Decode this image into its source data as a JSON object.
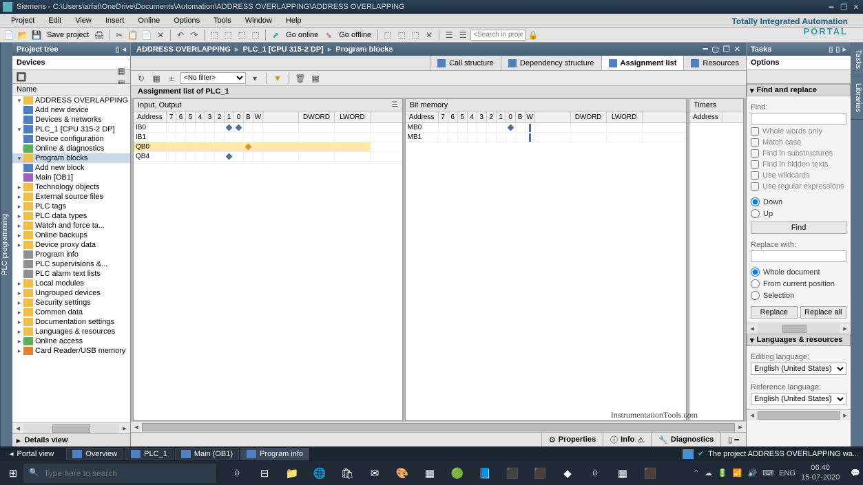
{
  "window": {
    "title": "Siemens  -  C:\\Users\\arfat\\OneDrive\\Documents\\Automation\\ADDRESS OVERLAPPING\\ADDRESS OVERLAPPING"
  },
  "menu": [
    "Project",
    "Edit",
    "View",
    "Insert",
    "Online",
    "Options",
    "Tools",
    "Window",
    "Help"
  ],
  "brand": {
    "line1": "Totally Integrated Automation",
    "line2": "PORTAL"
  },
  "toolbar": {
    "save": "Save project",
    "go_online": "Go online",
    "go_offline": "Go offline",
    "search_placeholder": "<Search in project>"
  },
  "project_tree": {
    "title": "Project tree",
    "tab": "Devices",
    "col": "Name",
    "details": "Details view",
    "nodes": [
      {
        "ind": 0,
        "exp": "▾",
        "icon": "ico-folder",
        "lbl": "ADDRESS OVERLAPPING"
      },
      {
        "ind": 1,
        "exp": "",
        "icon": "ico-blue",
        "lbl": "Add new device"
      },
      {
        "ind": 1,
        "exp": "",
        "icon": "ico-blue",
        "lbl": "Devices & networks"
      },
      {
        "ind": 1,
        "exp": "▾",
        "icon": "ico-blue",
        "lbl": "PLC_1 [CPU 315-2 DP]"
      },
      {
        "ind": 2,
        "exp": "",
        "icon": "ico-blue",
        "lbl": "Device configuration"
      },
      {
        "ind": 2,
        "exp": "",
        "icon": "ico-green",
        "lbl": "Online & diagnostics"
      },
      {
        "ind": 2,
        "exp": "▾",
        "icon": "ico-folder",
        "lbl": "Program blocks",
        "sel": true
      },
      {
        "ind": 3,
        "exp": "",
        "icon": "ico-blue",
        "lbl": "Add new block"
      },
      {
        "ind": 3,
        "exp": "",
        "icon": "ico-purple",
        "lbl": "Main [OB1]"
      },
      {
        "ind": 2,
        "exp": "▸",
        "icon": "ico-folder",
        "lbl": "Technology objects"
      },
      {
        "ind": 2,
        "exp": "▸",
        "icon": "ico-folder",
        "lbl": "External source files"
      },
      {
        "ind": 2,
        "exp": "▸",
        "icon": "ico-folder",
        "lbl": "PLC tags"
      },
      {
        "ind": 2,
        "exp": "▸",
        "icon": "ico-folder",
        "lbl": "PLC data types"
      },
      {
        "ind": 2,
        "exp": "▸",
        "icon": "ico-folder",
        "lbl": "Watch and force ta..."
      },
      {
        "ind": 2,
        "exp": "▸",
        "icon": "ico-folder",
        "lbl": "Online backups"
      },
      {
        "ind": 2,
        "exp": "▸",
        "icon": "ico-folder",
        "lbl": "Device proxy data"
      },
      {
        "ind": 2,
        "exp": "",
        "icon": "ico-gray",
        "lbl": "Program info"
      },
      {
        "ind": 2,
        "exp": "",
        "icon": "ico-gray",
        "lbl": "PLC supervisions &..."
      },
      {
        "ind": 2,
        "exp": "",
        "icon": "ico-gray",
        "lbl": "PLC alarm text lists"
      },
      {
        "ind": 2,
        "exp": "▸",
        "icon": "ico-folder",
        "lbl": "Local modules"
      },
      {
        "ind": 1,
        "exp": "▸",
        "icon": "ico-folder",
        "lbl": "Ungrouped devices"
      },
      {
        "ind": 1,
        "exp": "▸",
        "icon": "ico-folder",
        "lbl": "Security settings"
      },
      {
        "ind": 1,
        "exp": "▸",
        "icon": "ico-folder",
        "lbl": "Common data"
      },
      {
        "ind": 1,
        "exp": "▸",
        "icon": "ico-folder",
        "lbl": "Documentation settings"
      },
      {
        "ind": 1,
        "exp": "▸",
        "icon": "ico-folder",
        "lbl": "Languages & resources"
      },
      {
        "ind": 0,
        "exp": "▸",
        "icon": "ico-green",
        "lbl": "Online access"
      },
      {
        "ind": 0,
        "exp": "▸",
        "icon": "ico-orange",
        "lbl": "Card Reader/USB memory"
      }
    ]
  },
  "left_sidebar": "PLC programming",
  "breadcrumb": [
    "ADDRESS OVERLAPPING",
    "PLC_1 [CPU 315-2 DP]",
    "Program blocks"
  ],
  "view_tabs": [
    {
      "lbl": "Call structure"
    },
    {
      "lbl": "Dependency structure"
    },
    {
      "lbl": "Assignment list",
      "active": true
    },
    {
      "lbl": "Resources"
    }
  ],
  "editor": {
    "filter": "<No filter>",
    "title": "Assignment list of PLC_1",
    "panes": [
      {
        "header": "Input, Output",
        "cols": [
          "Address",
          "7",
          "6",
          "5",
          "4",
          "3",
          "2",
          "1",
          "0",
          "B",
          "W",
          "",
          "DWORD",
          "LWORD"
        ],
        "rows": [
          {
            "addr": "IB0",
            "marks": {
              "1": "blue",
              "0": "blue"
            }
          },
          {
            "addr": "IB1"
          },
          {
            "addr": "QB0",
            "hl": true,
            "marks": {
              "B": "orange"
            }
          },
          {
            "addr": "QB4",
            "marks": {
              "1": "blue"
            }
          }
        ]
      },
      {
        "header": "Bit memory",
        "cols": [
          "Address",
          "7",
          "6",
          "5",
          "4",
          "3",
          "2",
          "1",
          "0",
          "B",
          "W",
          "",
          "DWORD",
          "LWORD"
        ],
        "rows": [
          {
            "addr": "MB0",
            "marks": {
              "0": "blue",
              "W": "bar"
            }
          },
          {
            "addr": "MB1",
            "marks": {
              "W": "bar"
            }
          }
        ]
      },
      {
        "header": "Timers",
        "cols": [
          "Address"
        ],
        "rows": []
      }
    ]
  },
  "tasks": {
    "header": "Tasks",
    "options": "Options",
    "find_replace": "Find and replace",
    "find": "Find:",
    "whole": "Whole words only",
    "match": "Match case",
    "substr": "Find in substructures",
    "hidden": "Find in hidden texts",
    "wild": "Use wildcards",
    "regex": "Use regular expressions",
    "down": "Down",
    "up": "Up",
    "find_btn": "Find",
    "replace_with": "Replace with:",
    "whole_doc": "Whole document",
    "from_pos": "From current position",
    "selection": "Selection",
    "replace": "Replace",
    "replace_all": "Replace all",
    "lang_res": "Languages & resources",
    "edit_lang": "Editing language:",
    "ref_lang": "Reference language:",
    "lang_val": "English (United States)"
  },
  "right_tabs": [
    "Tasks",
    "Libraries"
  ],
  "bottom_tabs": [
    {
      "lbl": "Properties",
      "ico": "⚙"
    },
    {
      "lbl": "Info",
      "ico": "ⓘ",
      "extra": "⚠"
    },
    {
      "lbl": "Diagnostics",
      "ico": "🔧"
    }
  ],
  "status": {
    "portal": "Portal view",
    "tabs": [
      {
        "lbl": "Overview"
      },
      {
        "lbl": "PLC_1"
      },
      {
        "lbl": "Main (OB1)"
      },
      {
        "lbl": "Program info",
        "active": true
      }
    ],
    "msg": "The project ADDRESS OVERLAPPING wa..."
  },
  "taskbar": {
    "search": "Type here to search",
    "lang": "ENG",
    "time": "06:40",
    "date": "15-07-2020"
  },
  "watermark": "InstrumentationTools.com"
}
